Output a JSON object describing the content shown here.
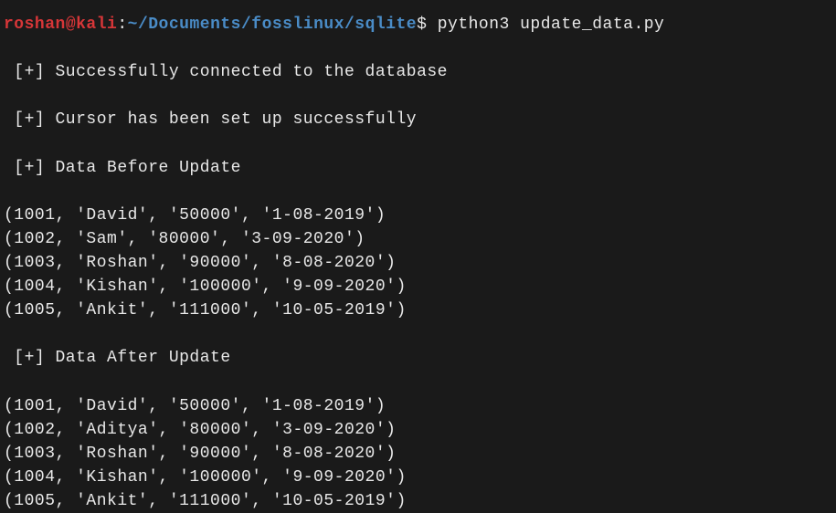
{
  "prompt": {
    "user": "roshan",
    "host": "kali",
    "path": "~/Documents/fosslinux/sqlite",
    "command": "python3 update_data.py"
  },
  "output": {
    "msg_connected": " [+] Successfully connected to the database",
    "msg_cursor": " [+] Cursor has been set up successfully",
    "header_before": " [+] Data Before Update",
    "header_after": " [+] Data After Update",
    "rows_before": [
      "(1001, 'David', '50000', '1-08-2019')",
      "(1002, 'Sam', '80000', '3-09-2020')",
      "(1003, 'Roshan', '90000', '8-08-2020')",
      "(1004, 'Kishan', '100000', '9-09-2020')",
      "(1005, 'Ankit', '111000', '10-05-2019')"
    ],
    "rows_after": [
      "(1001, 'David', '50000', '1-08-2019')",
      "(1002, 'Aditya', '80000', '3-09-2020')",
      "(1003, 'Roshan', '90000', '8-08-2020')",
      "(1004, 'Kishan', '100000', '9-09-2020')",
      "(1005, 'Ankit', '111000', '10-05-2019')"
    ]
  }
}
